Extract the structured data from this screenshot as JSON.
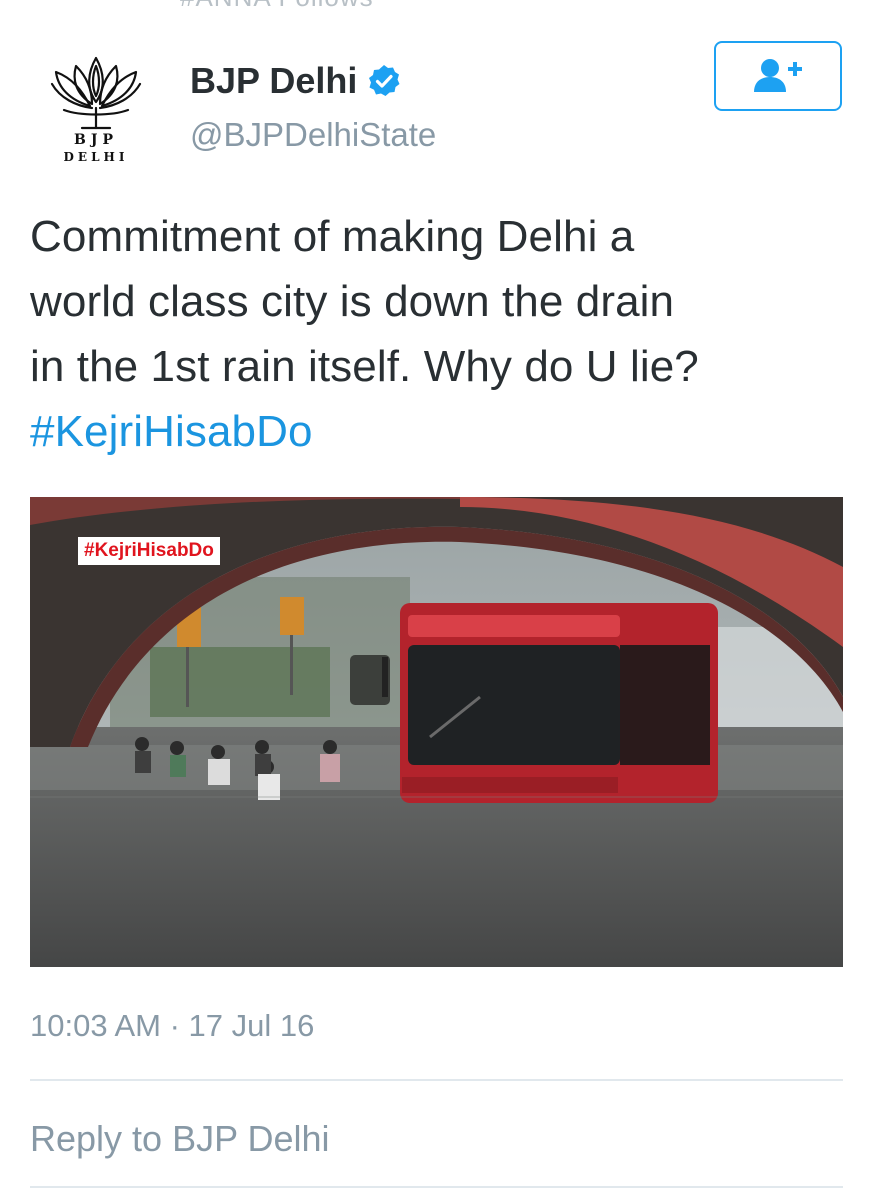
{
  "header_cut_text": "#ANNA Follows",
  "author": {
    "display_name": "BJP Delhi",
    "handle": "@BJPDelhiState",
    "verified": true,
    "avatar_text_line1": "BJP",
    "avatar_text_line2": "DELHI",
    "avatar_icon": "lotus-logo-icon"
  },
  "follow_button": {
    "icon": "add-user-icon",
    "color": "#1da1f2"
  },
  "tweet": {
    "lines": [
      "Commitment of making Delhi a",
      "world class city is down the drain",
      "in the 1st rain itself. Why do U lie?"
    ],
    "hashtag": "#KejriHisabDo",
    "hashtag_color": "#1b95e0"
  },
  "media": {
    "overlay_tag": "#KejriHisabDo",
    "overlay_tag_color": "#e0141e"
  },
  "timestamp": "10:03 AM · 17 Jul 16",
  "reply": {
    "placeholder": "Reply to BJP Delhi"
  }
}
